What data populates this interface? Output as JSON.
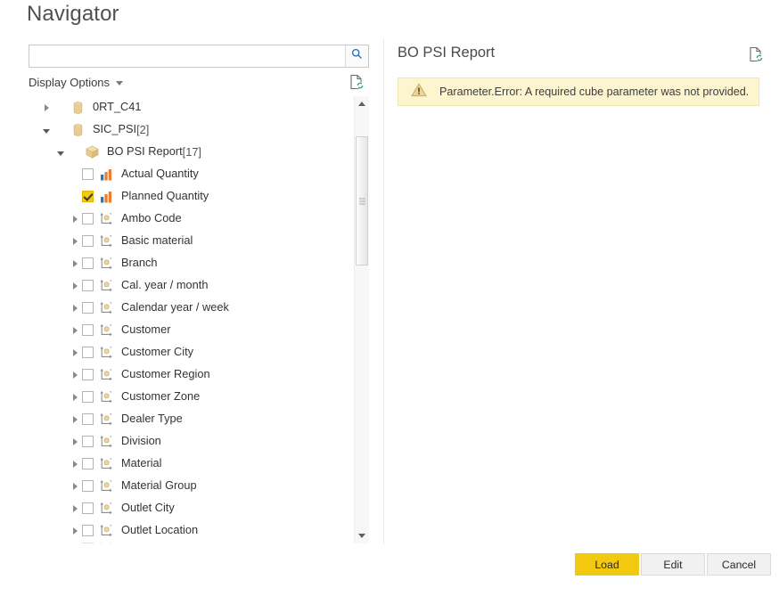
{
  "dialog": {
    "title": "Navigator"
  },
  "search": {
    "value": "",
    "placeholder": "",
    "icon": "search-icon"
  },
  "display_options": {
    "label": "Display Options",
    "caret_icon": "chevron-down-icon"
  },
  "left_refresh": {
    "icon": "document-refresh-icon"
  },
  "tree": {
    "items": [
      {
        "label": "0RT_C41",
        "count": "",
        "level": 0,
        "icon": "database-cylinder-icon",
        "expander": "collapsed",
        "checkbox": "none"
      },
      {
        "label": "SIC_PSI",
        "count": " [2]",
        "level": 0,
        "icon": "database-cylinder-icon",
        "expander": "expanded",
        "checkbox": "none"
      },
      {
        "label": "BO PSI Report",
        "count": " [17]",
        "level": 1,
        "icon": "cube-icon",
        "expander": "expanded",
        "checkbox": "none"
      },
      {
        "label": "Actual Quantity",
        "count": "",
        "level": 2,
        "icon": "measure-bars-icon",
        "expander": "none",
        "checkbox": "unchecked"
      },
      {
        "label": "Planned Quantity",
        "count": "",
        "level": 2,
        "icon": "measure-bars-icon",
        "expander": "none",
        "checkbox": "checked"
      },
      {
        "label": "Ambo Code",
        "count": "",
        "level": 2,
        "icon": "dimension-axis-icon",
        "expander": "collapsed",
        "checkbox": "unchecked"
      },
      {
        "label": "Basic material",
        "count": "",
        "level": 2,
        "icon": "dimension-axis-icon",
        "expander": "collapsed",
        "checkbox": "unchecked"
      },
      {
        "label": "Branch",
        "count": "",
        "level": 2,
        "icon": "dimension-axis-icon",
        "expander": "collapsed",
        "checkbox": "unchecked"
      },
      {
        "label": "Cal. year / month",
        "count": "",
        "level": 2,
        "icon": "dimension-axis-icon",
        "expander": "collapsed",
        "checkbox": "unchecked"
      },
      {
        "label": "Calendar year / week",
        "count": "",
        "level": 2,
        "icon": "dimension-axis-icon",
        "expander": "collapsed",
        "checkbox": "unchecked"
      },
      {
        "label": "Customer",
        "count": "",
        "level": 2,
        "icon": "dimension-axis-icon",
        "expander": "collapsed",
        "checkbox": "unchecked"
      },
      {
        "label": "Customer City",
        "count": "",
        "level": 2,
        "icon": "dimension-axis-icon",
        "expander": "collapsed",
        "checkbox": "unchecked"
      },
      {
        "label": "Customer Region",
        "count": "",
        "level": 2,
        "icon": "dimension-axis-icon",
        "expander": "collapsed",
        "checkbox": "unchecked"
      },
      {
        "label": "Customer Zone",
        "count": "",
        "level": 2,
        "icon": "dimension-axis-icon",
        "expander": "collapsed",
        "checkbox": "unchecked"
      },
      {
        "label": "Dealer Type",
        "count": "",
        "level": 2,
        "icon": "dimension-axis-icon",
        "expander": "collapsed",
        "checkbox": "unchecked"
      },
      {
        "label": "Division",
        "count": "",
        "level": 2,
        "icon": "dimension-axis-icon",
        "expander": "collapsed",
        "checkbox": "unchecked"
      },
      {
        "label": "Material",
        "count": "",
        "level": 2,
        "icon": "dimension-axis-icon",
        "expander": "collapsed",
        "checkbox": "unchecked"
      },
      {
        "label": "Material Group",
        "count": "",
        "level": 2,
        "icon": "dimension-axis-icon",
        "expander": "collapsed",
        "checkbox": "unchecked"
      },
      {
        "label": "Outlet City",
        "count": "",
        "level": 2,
        "icon": "dimension-axis-icon",
        "expander": "collapsed",
        "checkbox": "unchecked"
      },
      {
        "label": "Outlet Location",
        "count": "",
        "level": 2,
        "icon": "dimension-axis-icon",
        "expander": "collapsed",
        "checkbox": "unchecked"
      }
    ]
  },
  "scrollbar": {
    "up_icon": "scroll-up-arrow-icon",
    "down_icon": "scroll-down-arrow-icon"
  },
  "preview": {
    "title": "BO PSI Report",
    "refresh_icon": "document-refresh-icon",
    "error": {
      "icon": "warning-triangle-icon",
      "message": "Parameter.Error: A required cube parameter was not provided."
    }
  },
  "footer": {
    "load_label": "Load",
    "edit_label": "Edit",
    "cancel_label": "Cancel"
  },
  "colors": {
    "accent_yellow": "#f2c811",
    "warning_background": "#fdf5ce",
    "warning_border": "#f3e7b0",
    "title_gray": "#505050",
    "icon_gold": "#e5c07b",
    "measure_blue": "#2e75b6",
    "measure_orange": "#ed7d31"
  }
}
